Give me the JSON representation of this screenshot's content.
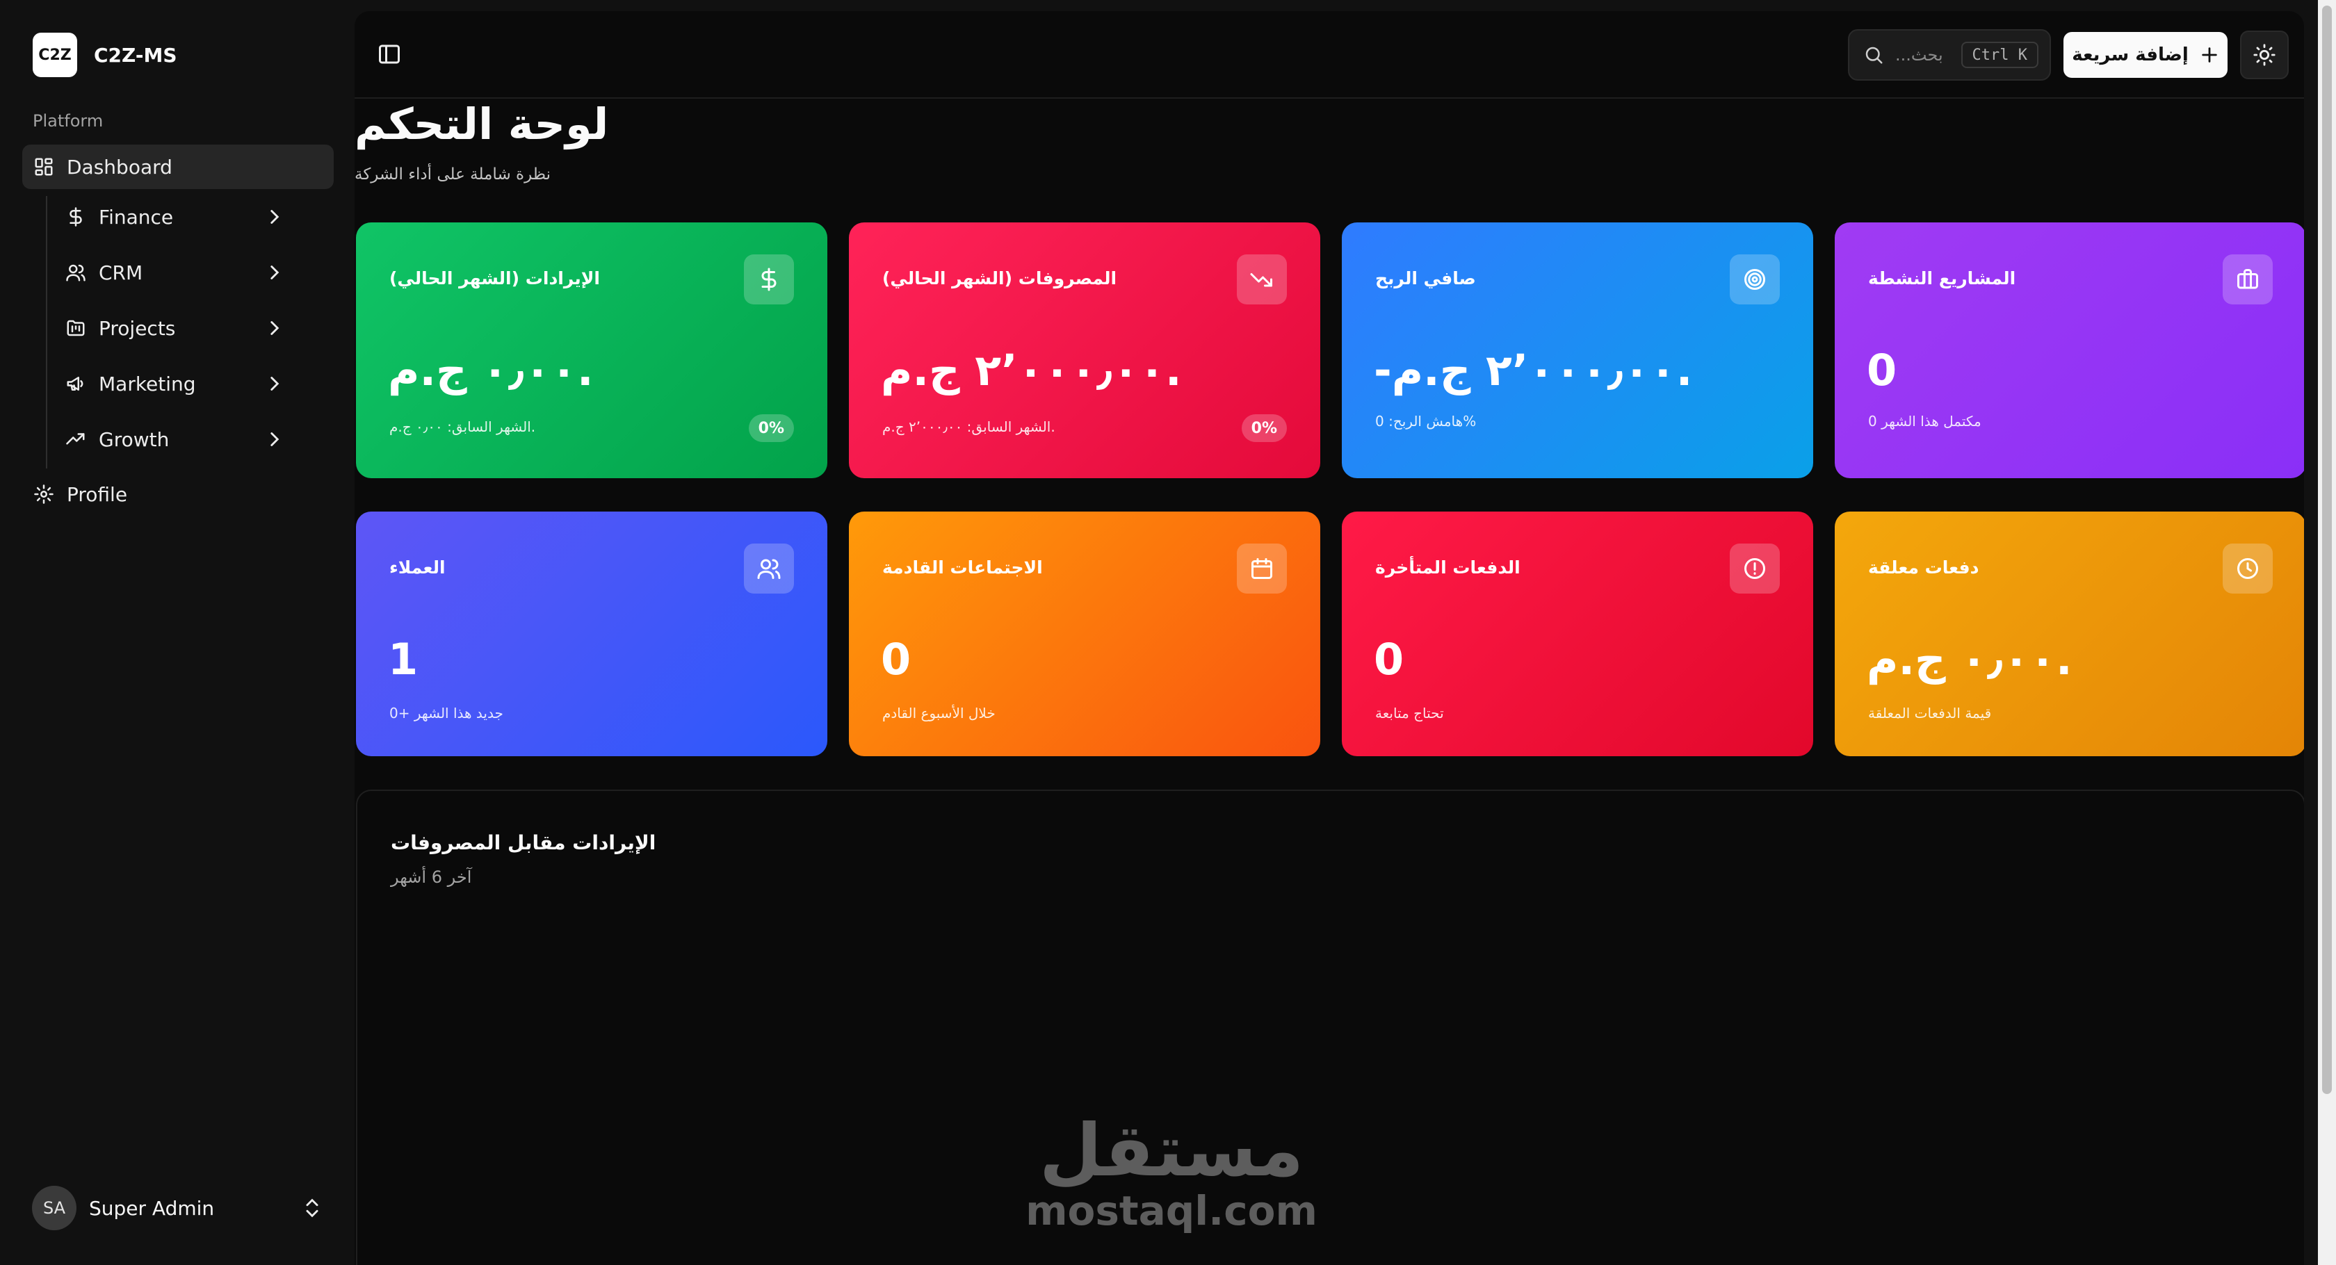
{
  "brand": {
    "logo": "C2Z",
    "name": "C2Z-MS"
  },
  "sidebar": {
    "group_label": "Platform",
    "items": [
      {
        "label": "Dashboard",
        "icon": "dashboard-grid-icon",
        "active": true
      },
      {
        "label": "Finance",
        "icon": "dollar-icon"
      },
      {
        "label": "CRM",
        "icon": "users-icon"
      },
      {
        "label": "Projects",
        "icon": "folder-kanban-icon"
      },
      {
        "label": "Marketing",
        "icon": "megaphone-icon"
      },
      {
        "label": "Growth",
        "icon": "trending-up-icon"
      },
      {
        "label": "Profile",
        "icon": "gear-icon"
      }
    ],
    "user": {
      "initials": "SA",
      "name": "Super Admin"
    }
  },
  "topbar": {
    "search_placeholder": "...بحث",
    "search_shortcut": "Ctrl K",
    "quick_add_label": "إضافة سريعة"
  },
  "page": {
    "title": "لوحة التحكم",
    "subtitle": "نظرة شاملة على أداء الشركة"
  },
  "cards": [
    {
      "title": "الإيرادات (الشهر الحالي)",
      "value": "٠٫٠٠ ج.م.",
      "note": "الشهر السابق: ٠٫٠٠ ج.م.",
      "badge": "0%",
      "icon": "dollar-icon",
      "color": "#05b257"
    },
    {
      "title": "المصروفات (الشهر الحالي)",
      "value": "٢٬٠٠٠٫٠٠ ج.م.",
      "note": "الشهر السابق: ٢٬٠٠٠٫٠٠ ج.م.",
      "badge": "0%",
      "icon": "trending-down-icon",
      "color": "#f4134a"
    },
    {
      "title": "صافي الربح",
      "value": "-٢٬٠٠٠٫٠٠ ج.م.",
      "note": "هامش الربح: 0%",
      "icon": "target-icon",
      "color": "#1c8ef4"
    },
    {
      "title": "المشاريع النشطة",
      "value": "0",
      "note": "مكتمل هذا الشهر 0",
      "icon": "briefcase-icon",
      "color": "#9536f5"
    },
    {
      "title": "العملاء",
      "value": "1",
      "note": "جديد هذا الشهر +0",
      "icon": "users-icon",
      "color": "#4457f8"
    },
    {
      "title": "الاجتماعات القادمة",
      "value": "0",
      "note": "خلال الأسبوع القادم",
      "icon": "calendar-icon",
      "color": "#fc760d"
    },
    {
      "title": "الدفعات المتأخرة",
      "value": "0",
      "note": "تحتاج متابعة",
      "icon": "alert-circle-icon",
      "color": "#f21139"
    },
    {
      "title": "دفعات معلقة",
      "value": "٠٫٠٠ ج.م.",
      "note": "قيمة الدفعات المعلقة",
      "icon": "clock-icon",
      "color": "#ec9609"
    }
  ],
  "chart_section": {
    "title": "الإيرادات مقابل المصروفات",
    "subtitle": "آخر 6 أشهر"
  },
  "watermark": {
    "ar": "مستقل",
    "en": "mostaql.com"
  }
}
